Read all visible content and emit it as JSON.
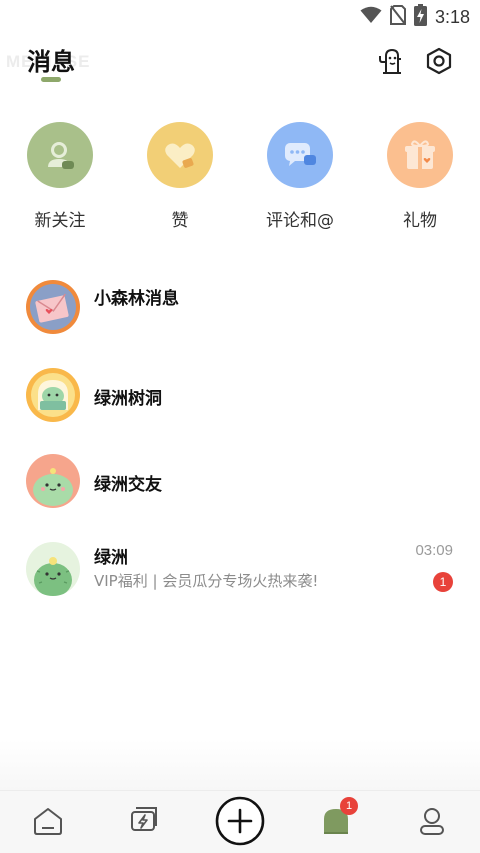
{
  "status_bar": {
    "time": "3:18",
    "icons": [
      "wifi-icon",
      "no-sim-icon",
      "battery-charging-icon"
    ]
  },
  "header": {
    "title": "消息",
    "watermark": "MEDIASE",
    "actions": [
      "cactus-icon",
      "settings-hexagon-icon"
    ],
    "accent_color": "#8ea86b"
  },
  "quick_actions": [
    {
      "label": "新关注",
      "icon": "new-follower-icon",
      "color": "#a9c08a"
    },
    {
      "label": "赞",
      "icon": "heart-like-icon",
      "color": "#f2cf76"
    },
    {
      "label": "评论和@",
      "icon": "comment-icon",
      "color": "#8fb8f5"
    },
    {
      "label": "礼物",
      "icon": "gift-icon",
      "color": "#fbbf8f"
    }
  ],
  "messages": [
    {
      "name": "小森林消息",
      "avatar": "envelope-avatar"
    },
    {
      "name": "绿洲树洞",
      "avatar": "tree-hollow-avatar"
    },
    {
      "name": "绿洲交友",
      "avatar": "cactus-friends-avatar"
    },
    {
      "name": "绿洲",
      "avatar": "oasis-cactus-avatar",
      "time": "03:09",
      "preview": "VIP福利 | 会员瓜分专场火热来袭!",
      "unread": "1"
    }
  ],
  "tab_bar": {
    "tabs": [
      "home-icon",
      "lightning-chat-icon",
      "add-icon",
      "notification-bell-icon",
      "profile-icon"
    ],
    "notification_badge": "1",
    "active_color": "#7f9a60",
    "badge_color": "#e8423a"
  }
}
